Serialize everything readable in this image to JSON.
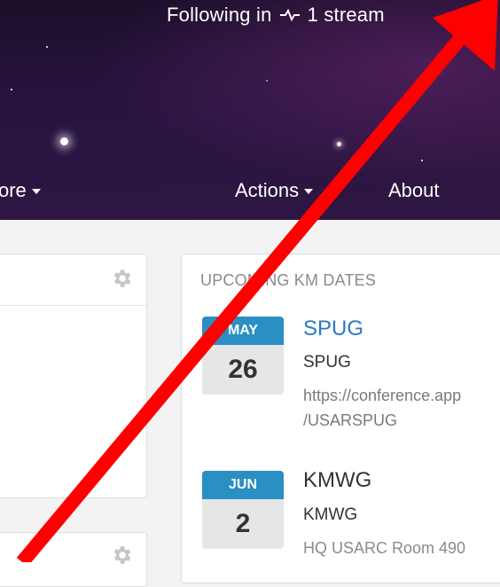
{
  "header": {
    "following_label": "Following in",
    "following_count": "1 stream",
    "nav": {
      "more_partial": "ore",
      "actions": "Actions",
      "about": "About"
    }
  },
  "upcoming": {
    "title": "UPCOMING KM DATES",
    "events": [
      {
        "month": "MAY",
        "day": "26",
        "title": "SPUG",
        "subtitle": "SPUG",
        "location_line1": "https://conference.app",
        "location_line2": "/USARSPUG"
      },
      {
        "month": "JUN",
        "day": "2",
        "title": "KMWG",
        "subtitle": "KMWG",
        "location_line1": "HQ USARC Room 490",
        "location_line2": ""
      }
    ]
  },
  "colors": {
    "accent": "#2a8fc2",
    "link": "#2a7ac2",
    "annotation_arrow": "#ff0000"
  },
  "icons": [
    "activity-icon",
    "caret-down-icon",
    "gear-icon"
  ]
}
